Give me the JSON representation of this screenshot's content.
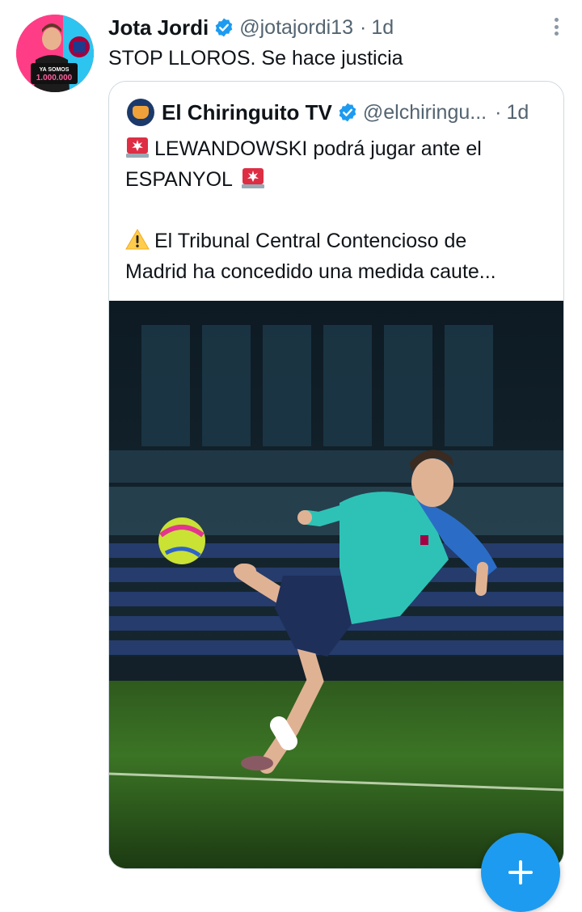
{
  "tweet": {
    "author_name": "Jota Jordi",
    "handle": "@jotajordi13",
    "separator": "·",
    "time": "1d",
    "text": "STOP LLOROS. Se hace justicia",
    "avatar_banner_line1": "YA SOMOS",
    "avatar_banner_line2": "1.000.000"
  },
  "quote": {
    "author_name": "El Chiringuito TV",
    "handle": "@elchiringu...",
    "separator": "·",
    "time": "1d",
    "line1": "LEWANDOWSKI podrá jugar ante el",
    "line2": "ESPANYOL",
    "line3": "El Tribunal Central Contencioso de",
    "line4": "Madrid ha concedido una medida caute..."
  },
  "icons": {
    "verified": "verified-badge-icon",
    "siren": "police-light-icon",
    "warning": "warning-icon",
    "more": "more-vertical-icon",
    "compose": "plus-icon"
  },
  "colors": {
    "verified": "#1d9bf0",
    "fab": "#1d9bf0",
    "muted_text": "#536471",
    "border": "#cfd9de"
  }
}
